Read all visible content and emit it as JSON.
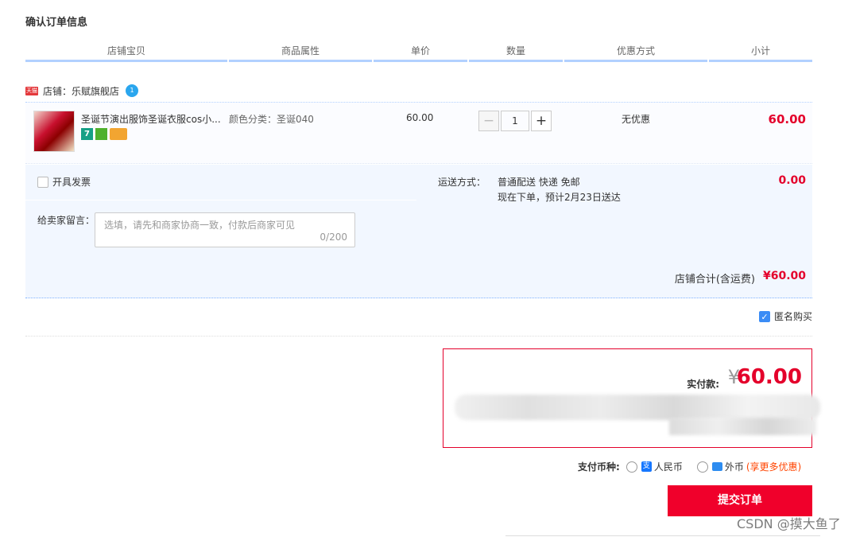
{
  "page": {
    "title": "确认订单信息",
    "columns": [
      "店铺宝贝",
      "商品属性",
      "单价",
      "数量",
      "优惠方式",
      "小计"
    ]
  },
  "store": {
    "badge": "天猫",
    "label": "店铺：乐赋旗舰店",
    "chat_badge": "1"
  },
  "item": {
    "name": "圣诞节演出服饰圣诞衣服cos小...",
    "icon_label": "7",
    "attribute": "颜色分类：圣诞040",
    "price": "60.00",
    "quantity": "1",
    "minus": "−",
    "plus": "+",
    "discount": "无优惠",
    "subtotal": "60.00"
  },
  "invoice": {
    "label": "开具发票"
  },
  "memo": {
    "label": "给卖家留言：",
    "placeholder": "选填，请先和商家协商一致，付款后商家可见",
    "count": "0/200"
  },
  "shipping": {
    "label": "运送方式：",
    "method": "普通配送 快递 免邮",
    "eta": "现在下单，预计2月23日送达",
    "fee": "0.00"
  },
  "store_total": {
    "label": "店铺合计(含运费)",
    "amount": "¥60.00"
  },
  "anonymous": {
    "label": "匿名购买",
    "checked": true
  },
  "payment": {
    "label": "实付款:",
    "currency_symbol": "¥",
    "amount": "60.00"
  },
  "currency": {
    "label": "支付币种:",
    "rmb": "人民币",
    "foreign": "外币",
    "promo": "(享更多优惠)"
  },
  "submit": {
    "label": "提交订单"
  },
  "watermark": "CSDN @摸大鱼了",
  "colors": {
    "accent": "#e4002b",
    "header_line": "#b2d1ff",
    "panel": "#f2f7ff"
  }
}
